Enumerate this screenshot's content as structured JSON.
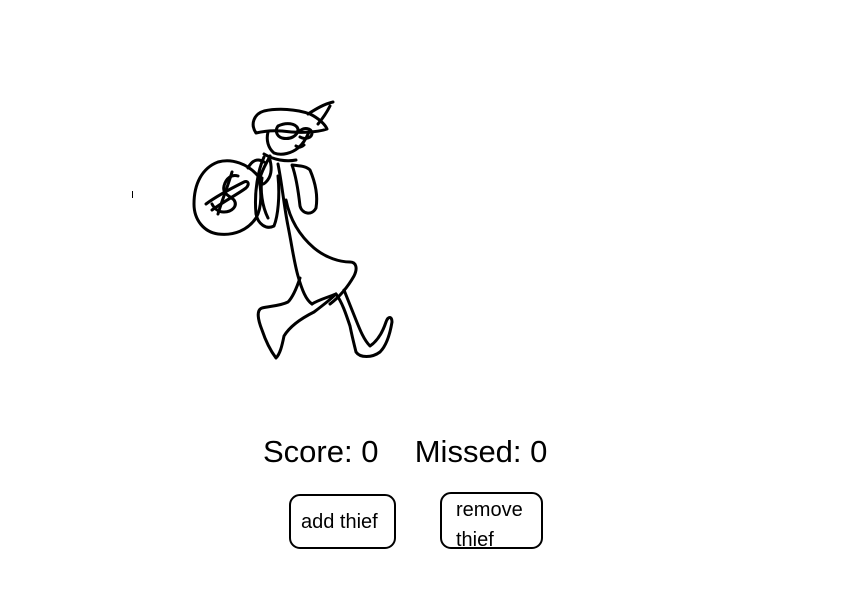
{
  "scoreboard": {
    "score_label": "Score:",
    "score_value": "0",
    "missed_label": "Missed:",
    "missed_value": "0"
  },
  "controls": {
    "add_label": "add thief",
    "remove_label": "remove thief"
  },
  "sprites": {
    "thief_icon": "thief-with-money-bag-icon"
  },
  "colors": {
    "background": "#ffffff",
    "ink": "#000000"
  }
}
